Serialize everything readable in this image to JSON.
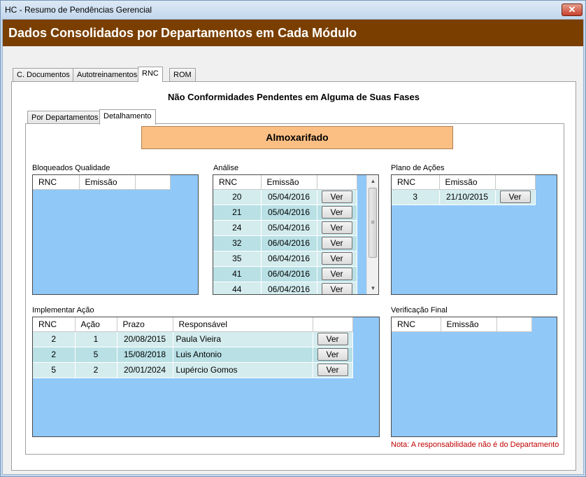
{
  "window": {
    "title": "HC - Resumo de Pendências Gerencial",
    "close_glyph": "✕"
  },
  "header": {
    "title": "Dados Consolidados por Departamentos em Cada Módulo"
  },
  "main_tabs": [
    "C. Documentos",
    "Autotreinamentos",
    "RNC",
    "ROM"
  ],
  "subtitle": "Não Conformidades Pendentes em Alguma de Suas Fases",
  "sub_tabs": [
    "Por Departamentos",
    "Detalhamento"
  ],
  "department": "Almoxarifado",
  "bloqueados": {
    "label": "Bloqueados Qualidade",
    "columns": [
      "RNC",
      "Emissão"
    ]
  },
  "analise": {
    "label": "Análise",
    "columns": [
      "RNC",
      "Emissão"
    ],
    "button": "Ver",
    "rows": [
      [
        "20",
        "05/04/2016"
      ],
      [
        "21",
        "05/04/2016"
      ],
      [
        "24",
        "05/04/2016"
      ],
      [
        "32",
        "06/04/2016"
      ],
      [
        "35",
        "06/04/2016"
      ],
      [
        "41",
        "06/04/2016"
      ],
      [
        "44",
        "06/04/2016"
      ]
    ]
  },
  "plano": {
    "label": "Plano de Ações",
    "columns": [
      "RNC",
      "Emissão"
    ],
    "button": "Ver",
    "rows": [
      [
        "3",
        "21/10/2015"
      ]
    ]
  },
  "implementar": {
    "label": "Implementar Ação",
    "columns": [
      "RNC",
      "Ação",
      "Prazo",
      "Responsável"
    ],
    "button": "Ver",
    "rows": [
      [
        "2",
        "1",
        "20/08/2015",
        "Paula Vieira"
      ],
      [
        "2",
        "5",
        "15/08/2018",
        "Luis Antonio"
      ],
      [
        "5",
        "2",
        "20/01/2024",
        "Lupércio Gomos"
      ]
    ]
  },
  "verificacao": {
    "label": "Verificação Final",
    "columns": [
      "RNC",
      "Emissão"
    ]
  },
  "note": "Nota: A responsabilidade não é do Departamento",
  "colors": {
    "header_bg": "#7a3f00",
    "grid_bg": "#90c8f8",
    "banner_bg": "#fbbf84",
    "note": "#c00000"
  }
}
